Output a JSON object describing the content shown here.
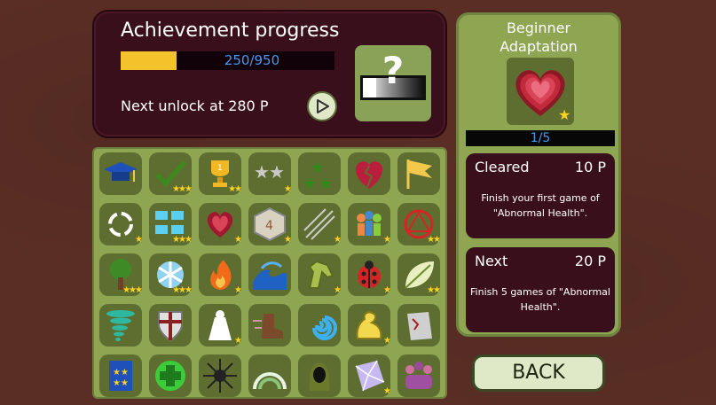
{
  "progress": {
    "title": "Achievement progress",
    "points_text": "250/950",
    "current": 250,
    "total": 950,
    "next_unlock": "Next unlock at 280 P",
    "mystery_glyph": "?"
  },
  "achievements": [
    {
      "icon": "graduation-cap-icon",
      "stars": 0
    },
    {
      "icon": "checkmark-icon",
      "stars": 3
    },
    {
      "icon": "trophy-icon",
      "stars": 2
    },
    {
      "icon": "silver-stars-icon",
      "stars": 1
    },
    {
      "icon": "green-stars-icon",
      "stars": 0
    },
    {
      "icon": "broken-heart-icon",
      "stars": 0
    },
    {
      "icon": "yellow-flag-icon",
      "stars": 0
    },
    {
      "icon": "recycle-arrows-icon",
      "stars": 1
    },
    {
      "icon": "blue-people-icon",
      "stars": 3
    },
    {
      "icon": "heart-icon",
      "stars": 1
    },
    {
      "icon": "four-die-icon",
      "stars": 1
    },
    {
      "icon": "arrows-icon",
      "stars": 1
    },
    {
      "icon": "crowd-icon",
      "stars": 1
    },
    {
      "icon": "red-magic-circle-icon",
      "stars": 2
    },
    {
      "icon": "tree-icon",
      "stars": 3
    },
    {
      "icon": "snowflake-icon",
      "stars": 3
    },
    {
      "icon": "flame-icon",
      "stars": 1
    },
    {
      "icon": "wave-icon",
      "stars": 0
    },
    {
      "icon": "horse-head-icon",
      "stars": 1
    },
    {
      "icon": "ladybug-icon",
      "stars": 1
    },
    {
      "icon": "leaf-icon",
      "stars": 2
    },
    {
      "icon": "tornado-icon",
      "stars": 0
    },
    {
      "icon": "shield-icon",
      "stars": 0
    },
    {
      "icon": "light-beam-icon",
      "stars": 1
    },
    {
      "icon": "speed-boot-icon",
      "stars": 0
    },
    {
      "icon": "spiral-icon",
      "stars": 0
    },
    {
      "icon": "muscle-icon",
      "stars": 1
    },
    {
      "icon": "torn-paper-icon",
      "stars": 0
    },
    {
      "icon": "blue-book-icon",
      "stars": 0
    },
    {
      "icon": "green-cross-icon",
      "stars": 0
    },
    {
      "icon": "dark-sun-icon",
      "stars": 0
    },
    {
      "icon": "rainbow-icon",
      "stars": 0
    },
    {
      "icon": "hooded-figure-icon",
      "stars": 0
    },
    {
      "icon": "crystal-icon",
      "stars": 1
    },
    {
      "icon": "group-icon",
      "stars": 0
    }
  ],
  "detail": {
    "title_line1": "Beginner",
    "title_line2": "Adaptation",
    "badge_icon": "layered-heart-icon",
    "level": "1/5",
    "cleared_label": "Cleared",
    "cleared_points": "10 P",
    "cleared_desc": "Finish your first game of \"Abnormal Health\".",
    "next_label": "Next",
    "next_points": "20 P",
    "next_desc": "Finish 5 games of \"Abnormal Health\"."
  },
  "buttons": {
    "back_label": "BACK"
  },
  "colors": {
    "star": "#ffd21d",
    "bar_fill": "#f4c22b",
    "bar_text": "#4a97f0",
    "panel_dark": "#3a0f1c",
    "panel_green": "#8ea552"
  }
}
